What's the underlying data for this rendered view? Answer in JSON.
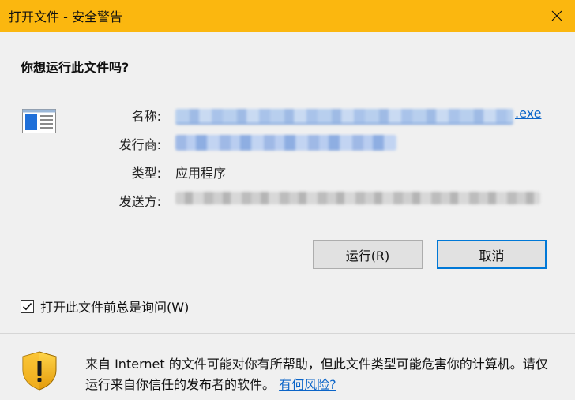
{
  "window": {
    "title": "打开文件 - 安全警告",
    "accent_color": "#fbb70f"
  },
  "dialog": {
    "question": "你想运行此文件吗?",
    "fields": {
      "name_label": "名称:",
      "name_suffix": ".exe",
      "publisher_label": "发行商:",
      "type_label": "类型:",
      "type_value": "应用程序",
      "from_label": "发送方:"
    },
    "buttons": {
      "run": "运行(R)",
      "cancel": "取消"
    },
    "checkbox": {
      "label": "打开此文件前总是询问(W)",
      "checked": true
    },
    "warning": {
      "text": "来自 Internet 的文件可能对你有所帮助，但此文件类型可能危害你的计算机。请仅运行来自你信任的发布者的软件。",
      "link": "有何风险?"
    }
  },
  "icons": [
    "close-icon",
    "application-icon",
    "checkmark-icon",
    "shield-warning-icon"
  ]
}
